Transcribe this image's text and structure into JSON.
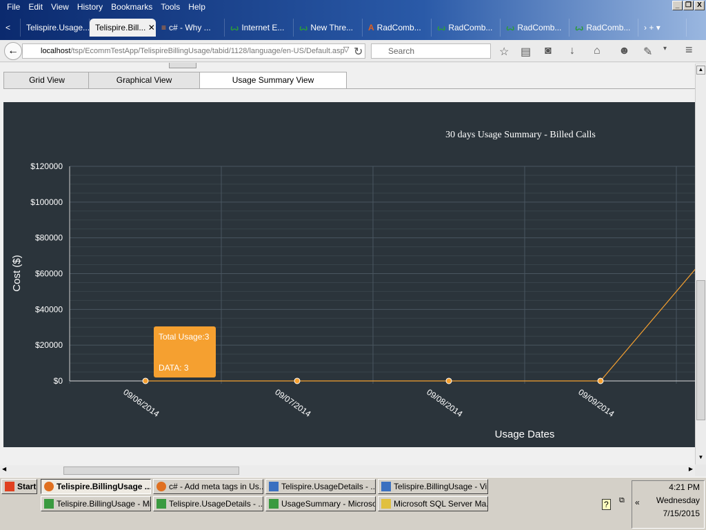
{
  "browser": {
    "menu": [
      "File",
      "Edit",
      "View",
      "History",
      "Bookmarks",
      "Tools",
      "Help"
    ],
    "tabs": [
      {
        "label": "Telispire.Usage...",
        "icon": "page-icon"
      },
      {
        "label": "Telispire.Bill...",
        "icon": "page-icon",
        "active": true
      },
      {
        "label": "c# - Why ...",
        "icon": "stackoverflow-icon"
      },
      {
        "label": "Internet E...",
        "icon": "telerik-icon"
      },
      {
        "label": "New Thre...",
        "icon": "telerik-icon"
      },
      {
        "label": "RadComb...",
        "icon": "telerik-icon"
      },
      {
        "label": "RadComb...",
        "icon": "telerik-icon"
      },
      {
        "label": "RadComb...",
        "icon": "telerik-icon"
      },
      {
        "label": "RadComb...",
        "icon": "telerik-icon"
      }
    ],
    "url_host": "localhost",
    "url_path": "/tsp/EcommTestApp/TelispireBillingUsage/tabid/1128/language/en-US/Default.asp",
    "search_placeholder": "Search"
  },
  "page": {
    "view_tabs": [
      "Grid View",
      "Graphical View",
      "Usage Summary View"
    ],
    "active_view": "Usage Summary View"
  },
  "chart_data": {
    "type": "line",
    "title": "30 days Usage Summary - Billed Calls",
    "xlabel": "Usage Dates",
    "ylabel": "Cost ($)",
    "categories": [
      "09/06/2014",
      "09/07/2014",
      "09/08/2014",
      "09/09/2014"
    ],
    "series": [
      {
        "name": "Total Usage",
        "values": [
          3,
          3,
          3,
          3
        ],
        "offscreen_next_value": 100000
      }
    ],
    "ylim": [
      0,
      120000
    ],
    "yticks": [
      "$0",
      "$20000",
      "$40000",
      "$60000",
      "$80000",
      "$100000",
      "$120000"
    ],
    "tooltip": {
      "line1": "Total Usage:3",
      "line2": "DATA: 3"
    },
    "colors": {
      "line": "#f5a030",
      "bg": "#2b343b"
    }
  },
  "taskbar": {
    "start": "Start",
    "buttons": [
      "Telispire.BillingUsage ...",
      "c# - Add meta tags in Us...",
      "Telispire.UsageDetails - ...",
      "Telispire.BillingUsage - Vi...",
      "Telispire.BillingUsage - Mi...",
      "Telispire.UsageDetails - ...",
      "UsageSummary - Microso...",
      "Microsoft SQL Server Ma..."
    ],
    "time": "4:21 PM",
    "day": "Wednesday",
    "date": "7/15/2015"
  }
}
